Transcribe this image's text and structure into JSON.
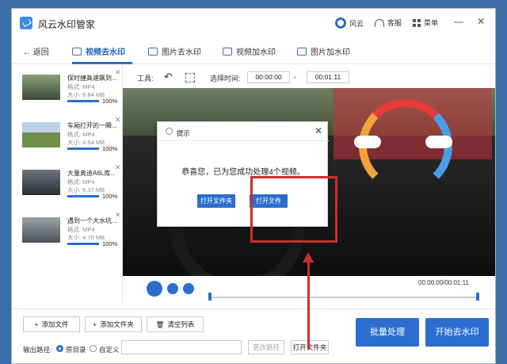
{
  "app": {
    "title": "风云水印管家"
  },
  "titlebar": {
    "user": "风云",
    "service": "客服",
    "menu": "菜单",
    "minimize": "—",
    "close": "✕"
  },
  "nav": {
    "back": "返回",
    "tabs": [
      {
        "label": "视频去水印"
      },
      {
        "label": "图片去水印"
      },
      {
        "label": "视频加水印"
      },
      {
        "label": "图片加水印"
      }
    ]
  },
  "files": [
    {
      "name": "保时捷高速飙到...",
      "format": "格式: MP4",
      "size": "大小: 6.84 MB",
      "progress": "100%"
    },
    {
      "name": "车厢打开的一瞬...",
      "format": "格式: MP4",
      "size": "大小: 4.54 MB",
      "progress": "100%"
    },
    {
      "name": "大量奥迪A6L库...",
      "format": "格式: MP4",
      "size": "大小: 6.37 MB",
      "progress": "100%"
    },
    {
      "name": "遇到一个大水坑...",
      "format": "格式: MP4",
      "size": "大小: 4.70 MB",
      "progress": "100%"
    }
  ],
  "tools": {
    "label": "工具:",
    "select_time": "选择时间:",
    "start": "00:00:00",
    "dash": "-",
    "end": "00:01:11"
  },
  "dialog": {
    "title": "提示",
    "message": "恭喜您，已为您成功处理4个视频。",
    "btn_folder": "打开文件夹",
    "btn_file": "打开文件"
  },
  "player": {
    "time": "00:00:00/00:01:11"
  },
  "bottom": {
    "add_file": "添加文件",
    "add_folder": "添加文件夹",
    "clear": "清空列表",
    "output_label": "输出路径:",
    "orig_dir": "原目录",
    "custom": "自定义",
    "change_path": "更改路径",
    "open_folder": "打开文件夹",
    "batch": "批量处理",
    "start": "开始去水印"
  },
  "colors": {
    "accent": "#2b6ecf",
    "highlight": "#c9302c"
  }
}
